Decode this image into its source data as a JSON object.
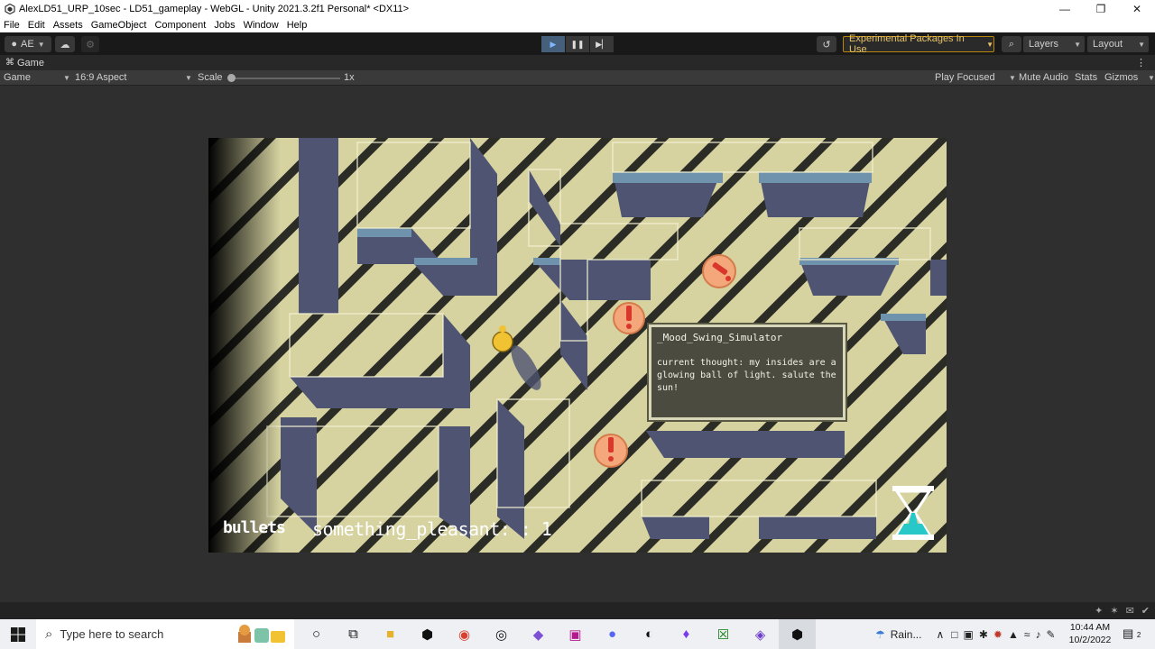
{
  "window": {
    "title": "AlexLD51_URP_10sec - LD51_gameplay - WebGL - Unity 2021.3.2f1 Personal* <DX11>"
  },
  "menu": [
    "File",
    "Edit",
    "Assets",
    "GameObject",
    "Component",
    "Jobs",
    "Window",
    "Help"
  ],
  "toolbar": {
    "account_label": "AE",
    "experimental_label": "Experimental Packages In Use",
    "layers_label": "Layers",
    "layout_label": "Layout"
  },
  "game_tab": {
    "tab_label": "Game",
    "display_label": "Game",
    "aspect_label": "16:9 Aspect",
    "scale_label": "Scale",
    "scale_value": "1x",
    "play_mode_label": "Play Focused",
    "mute_label": "Mute Audio",
    "stats_label": "Stats",
    "gizmos_label": "Gizmos"
  },
  "hud": {
    "dialog_title": "_Mood_Swing_Simulator",
    "dialog_text": "current thought: my insides are a glowing ball of light. salute the sun!",
    "weapon_label": "bullets",
    "counter_text": "something_pleasant: : 1"
  },
  "taskbar": {
    "search_placeholder": "Type here to search",
    "weather_label": "Rain...",
    "time": "10:44 AM",
    "date": "10/2/2022",
    "notification_count": "2"
  },
  "colors": {
    "floor": "#d6d3a1",
    "wall_shadow": "#4e5472",
    "stripe": "#2c2c26",
    "hourglass": "#28c8c8",
    "experimental_accent": "#e6c36a"
  }
}
